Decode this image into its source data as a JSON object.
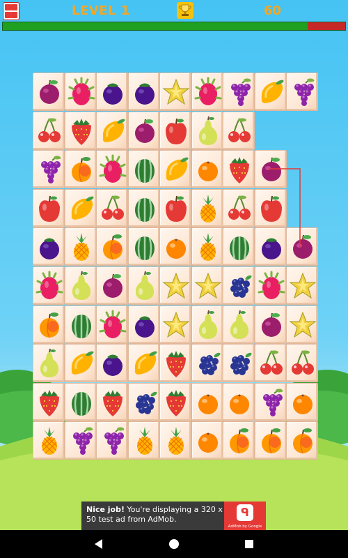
{
  "hud": {
    "level_label": "LEVEL 1",
    "score": "60",
    "menu_icon": "cards-icon",
    "trophy_icon": "trophy-icon",
    "time_remaining_fraction": 0.89,
    "time_bar_color": "#20a020",
    "time_bar_bg": "#c62828"
  },
  "board": {
    "rows": 10,
    "cols": 9,
    "tiles": [
      [
        "plum",
        "dragonfruit",
        "mangosteen",
        "mangosteen",
        "starfruit",
        "dragonfruit",
        "grapes",
        "mango",
        "grapes"
      ],
      [
        "cherries",
        "strawberry",
        "mango",
        "plum",
        "apple",
        "pear",
        "cherries",
        null,
        null
      ],
      [
        "grapes",
        "peach",
        "dragonfruit",
        "watermelon",
        "mango",
        "orange",
        "strawberry",
        "plum",
        null
      ],
      [
        "apple",
        "mango",
        "cherries",
        "watermelon",
        "apple",
        "pineapple",
        "cherries",
        "apple",
        null
      ],
      [
        "mangosteen",
        "pineapple",
        "peach",
        "watermelon",
        "orange",
        "pineapple",
        "watermelon",
        "mangosteen",
        "plum"
      ],
      [
        "dragonfruit",
        "pear",
        "plum",
        "pear",
        "starfruit",
        "starfruit",
        "blackberry",
        "dragonfruit",
        "starfruit"
      ],
      [
        "peach",
        "watermelon",
        "dragonfruit",
        "mangosteen",
        "starfruit",
        "pear",
        "pear",
        "plum",
        "starfruit"
      ],
      [
        "pear",
        "mango",
        "mangosteen",
        "mango",
        "strawberry",
        "blackberry",
        "blackberry",
        "cherries",
        "cherries"
      ],
      [
        "strawberry",
        "watermelon",
        "strawberry",
        "blackberry",
        "strawberry",
        "orange",
        "orange",
        "grapes",
        "orange"
      ],
      [
        "pineapple",
        "grapes",
        "grapes",
        "pineapple",
        "pineapple",
        "orange",
        "peach",
        "peach",
        "peach"
      ]
    ],
    "connector_color": "#e53935"
  },
  "ad": {
    "headline": "Nice job!",
    "body": " You're displaying a 320 x 50 test ad from AdMob.",
    "logo_caption": "AdMob by Google",
    "logo_icon": "admob-icon",
    "colors": {
      "bg": "#3a3a3a",
      "logo_bg": "#e53935"
    }
  },
  "navbar": {
    "back_icon": "back-triangle-icon",
    "home_icon": "home-circle-icon",
    "recents_icon": "recents-square-icon"
  }
}
